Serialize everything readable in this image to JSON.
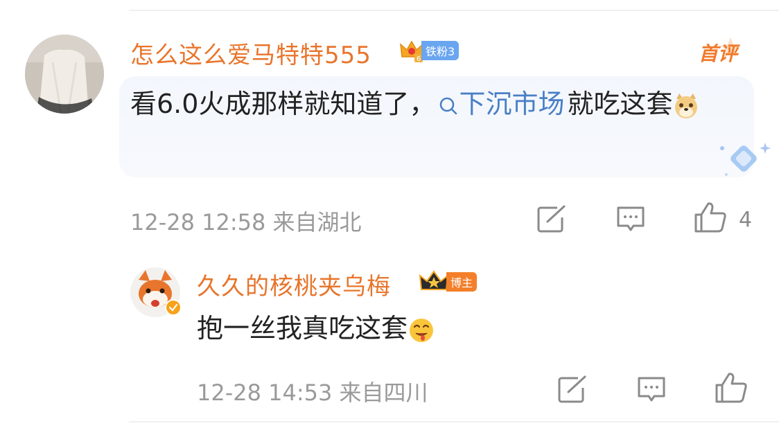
{
  "comment": {
    "user_name": "怎么这么爱马特特555",
    "fan_badge": "铁粉3",
    "first_tag": "首评",
    "text_before": "看6.0火成那样就知道了，",
    "hashtag": "下沉市场",
    "text_after": "就吃这套",
    "emoji_icon": "doge-emoji",
    "meta": "12-28 12:58 来自湖北",
    "like_count": "4"
  },
  "reply": {
    "user_name": "久久的核桃夹乌梅",
    "role_badge": "博主",
    "text": "抱一丝我真吃这套",
    "emoji_icon": "drooling-emoji",
    "meta": "12-28 14:53 来自四川"
  },
  "colors": {
    "name": "#e8752c",
    "hashtag": "#4a7fc6",
    "meta": "#9a9a9a",
    "icon": "#8a8a8a"
  }
}
